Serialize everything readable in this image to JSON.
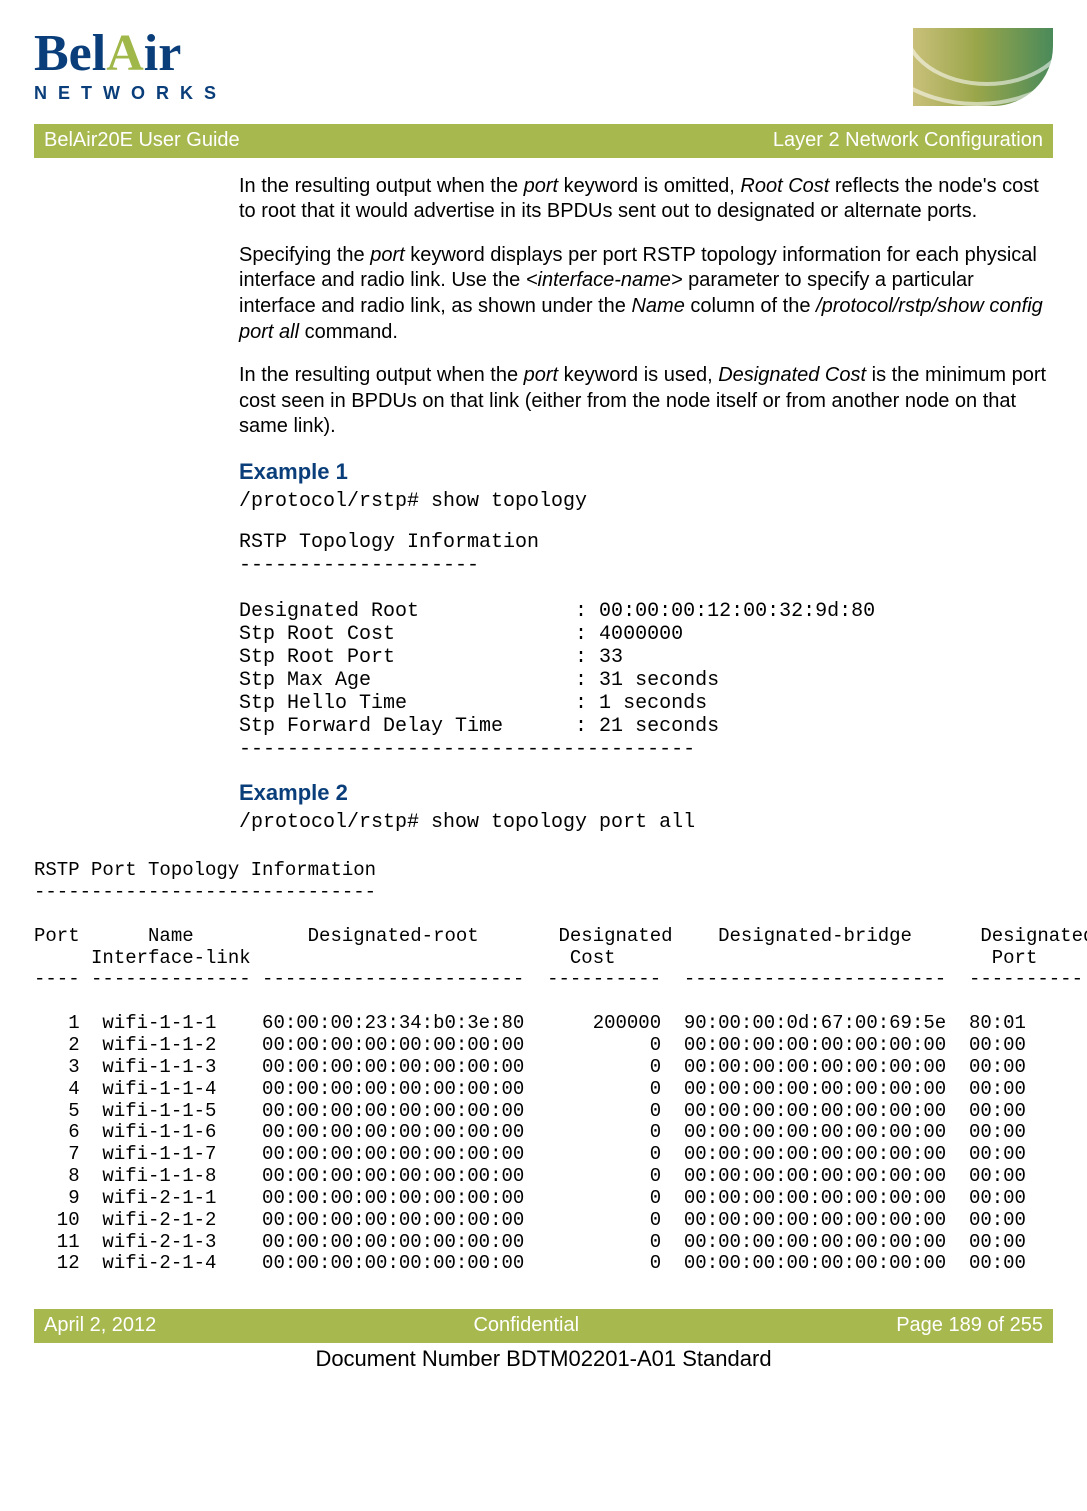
{
  "logo": {
    "word": "BelAir",
    "accent_letter_index": 3,
    "sub": "NETWORKS"
  },
  "bar": {
    "left": "BelAir20E User Guide",
    "right": "Layer 2 Network Configuration"
  },
  "para1": {
    "a": "In the resulting output when the ",
    "kw1": "port",
    "b": " keyword is omitted, ",
    "kw2": "Root Cost",
    "c": " reflects the node's cost to root that it would advertise in its BPDUs sent out to designated or alternate ports."
  },
  "para2": {
    "a": "Specifying the ",
    "kw1": "port",
    "b": " keyword displays per port RSTP topology information for each physical interface and radio link. Use the ",
    "kw2": "<interface-name>",
    "c": " parameter to specify a particular interface and radio link, as shown under the ",
    "kw3": "Name",
    "d": " column of the ",
    "kw4": "/protocol/rstp/show config port all",
    "e": " command."
  },
  "para3": {
    "a": "In the resulting output when the ",
    "kw1": "port",
    "b": " keyword is used, ",
    "kw2": "Designated Cost",
    "c": " is the minimum port cost seen in BPDUs on that link (either from the node itself or from another node on that same link)."
  },
  "ex1": {
    "title": "Example 1",
    "cmd": "/protocol/rstp# show topology",
    "out": "RSTP Topology Information\n--------------------\n\nDesignated Root             : 00:00:00:12:00:32:9d:80\nStp Root Cost               : 4000000\nStp Root Port               : 33\nStp Max Age                 : 31 seconds\nStp Hello Time              : 1 seconds\nStp Forward Delay Time      : 21 seconds\n--------------------------------------"
  },
  "ex2": {
    "title": "Example 2",
    "cmd": "/protocol/rstp# show topology port all",
    "out": "RSTP Port Topology Information\n------------------------------\n\nPort      Name          Designated-root       Designated    Designated-bridge      Designated\n     Interface-link                            Cost                                 Port\n---- -------------- -----------------------  ----------  -----------------------  ----------\n\n   1  wifi-1-1-1    60:00:00:23:34:b0:3e:80      200000  90:00:00:0d:67:00:69:5e  80:01\n   2  wifi-1-1-2    00:00:00:00:00:00:00:00           0  00:00:00:00:00:00:00:00  00:00\n   3  wifi-1-1-3    00:00:00:00:00:00:00:00           0  00:00:00:00:00:00:00:00  00:00\n   4  wifi-1-1-4    00:00:00:00:00:00:00:00           0  00:00:00:00:00:00:00:00  00:00\n   5  wifi-1-1-5    00:00:00:00:00:00:00:00           0  00:00:00:00:00:00:00:00  00:00\n   6  wifi-1-1-6    00:00:00:00:00:00:00:00           0  00:00:00:00:00:00:00:00  00:00\n   7  wifi-1-1-7    00:00:00:00:00:00:00:00           0  00:00:00:00:00:00:00:00  00:00\n   8  wifi-1-1-8    00:00:00:00:00:00:00:00           0  00:00:00:00:00:00:00:00  00:00\n   9  wifi-2-1-1    00:00:00:00:00:00:00:00           0  00:00:00:00:00:00:00:00  00:00\n  10  wifi-2-1-2    00:00:00:00:00:00:00:00           0  00:00:00:00:00:00:00:00  00:00\n  11  wifi-2-1-3    00:00:00:00:00:00:00:00           0  00:00:00:00:00:00:00:00  00:00\n  12  wifi-2-1-4    00:00:00:00:00:00:00:00           0  00:00:00:00:00:00:00:00  00:00"
  },
  "footer": {
    "left": "April 2, 2012",
    "mid": "Confidential",
    "right": "Page 189 of 255",
    "docnum": "Document Number BDTM02201-A01 Standard"
  }
}
